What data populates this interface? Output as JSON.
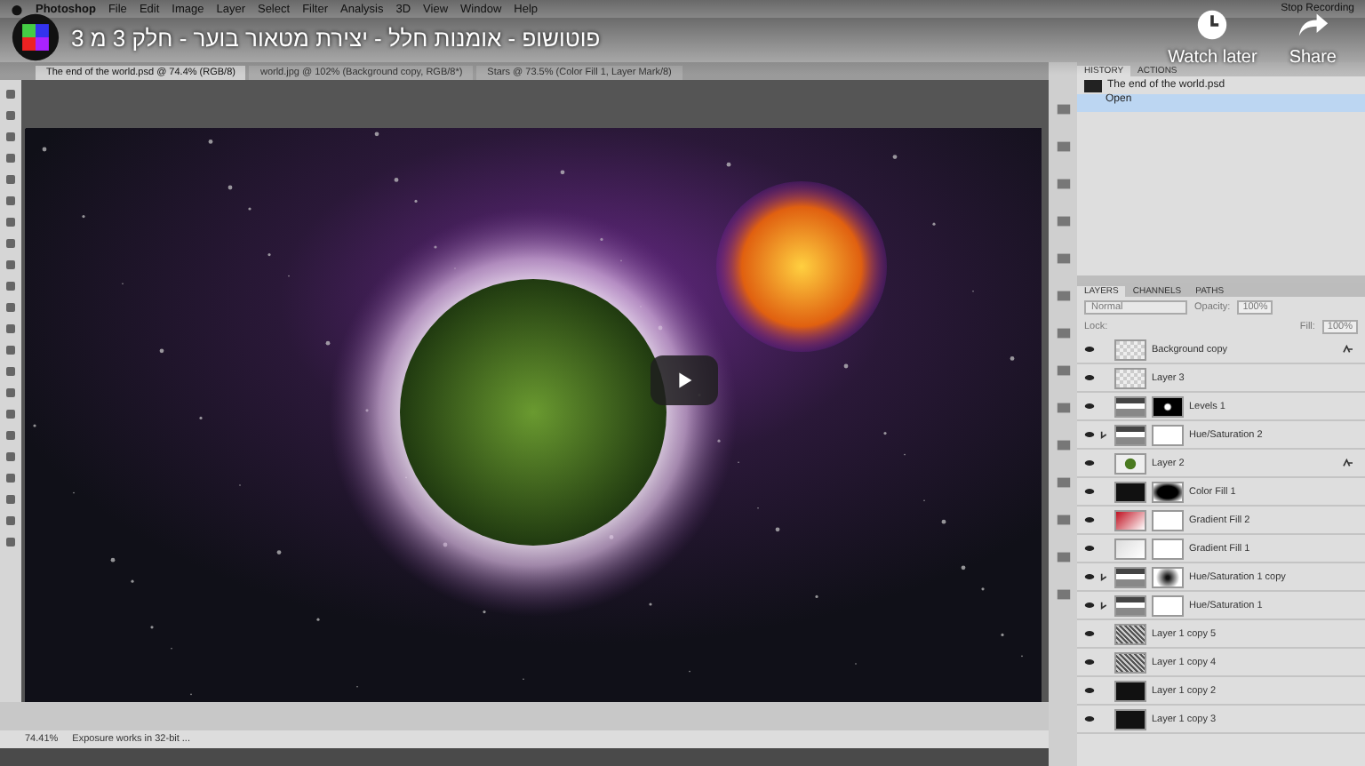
{
  "video": {
    "title": "פוטושופ - אומנות חלל - יצירת מטאור בוער - חלק 3 מ 3",
    "actions": [
      {
        "kind": "clock",
        "label": "Watch later"
      },
      {
        "kind": "share",
        "label": "Share"
      }
    ]
  },
  "menubar": {
    "app": "Photoshop",
    "items": [
      "File",
      "Edit",
      "Image",
      "Layer",
      "Select",
      "Filter",
      "Analysis",
      "3D",
      "View",
      "Window",
      "Help"
    ],
    "recording": "Stop Recording"
  },
  "doc_tabs": [
    {
      "label": "The end of the world.psd @ 74.4% (RGB/8)",
      "selected": true
    },
    {
      "label": "world.jpg @ 102% (Background copy, RGB/8*)",
      "selected": false
    },
    {
      "label": "Stars @ 73.5% (Color Fill 1, Layer Mark/8)",
      "selected": false
    }
  ],
  "history": {
    "tabs": [
      {
        "label": "HISTORY",
        "selected": true
      },
      {
        "label": "ACTIONS",
        "selected": false
      }
    ],
    "snapshot": "The end of the world.psd",
    "states": [
      {
        "label": "Open",
        "selected": true
      }
    ]
  },
  "layers": {
    "tabs": [
      {
        "label": "LAYERS",
        "selected": true
      },
      {
        "label": "CHANNELS",
        "selected": false
      },
      {
        "label": "PATHS",
        "selected": false
      }
    ],
    "blend": "Normal",
    "opacity_label": "Opacity:",
    "opacity": "100%",
    "lock_label": "Lock:",
    "fill_label": "Fill:",
    "fill": "100%",
    "rows": [
      {
        "name": "Background copy",
        "thumb": {
          "kind": "transparent"
        },
        "clipped": false,
        "fx": true
      },
      {
        "name": "Layer 3",
        "thumb": {
          "kind": "transparent"
        },
        "clipped": false,
        "fx": false
      },
      {
        "name": "Levels 1",
        "thumb": {
          "kind": "adjustment"
        },
        "mask": {
          "kind": "dot"
        },
        "clipped": false,
        "fx": false
      },
      {
        "name": "Hue/Saturation 2",
        "thumb": {
          "kind": "adjustment"
        },
        "mask": {
          "kind": "white"
        },
        "clipped": true,
        "fx": false
      },
      {
        "name": "Layer 2",
        "thumb": {
          "kind": "planet"
        },
        "clipped": false,
        "fx": true
      },
      {
        "name": "Color Fill 1",
        "thumb": {
          "kind": "black"
        },
        "mask": {
          "kind": "blur"
        },
        "clipped": false,
        "fx": false
      },
      {
        "name": "Gradient Fill 2",
        "thumb": {
          "kind": "gradient"
        },
        "mask": {
          "kind": "white"
        },
        "clipped": false,
        "fx": false
      },
      {
        "name": "Gradient Fill 1",
        "thumb": {
          "kind": "white"
        },
        "mask": {
          "kind": "white"
        },
        "clipped": false,
        "fx": false
      },
      {
        "name": "Hue/Saturation 1 copy",
        "thumb": {
          "kind": "adjustment"
        },
        "mask": {
          "kind": "radial"
        },
        "clipped": true,
        "fx": false
      },
      {
        "name": "Hue/Saturation 1",
        "thumb": {
          "kind": "adjustment"
        },
        "mask": {
          "kind": "white"
        },
        "clipped": true,
        "fx": false
      },
      {
        "name": "Layer 1 copy 5",
        "thumb": {
          "kind": "noise"
        },
        "clipped": false,
        "fx": false
      },
      {
        "name": "Layer 1 copy 4",
        "thumb": {
          "kind": "noise"
        },
        "clipped": false,
        "fx": false
      },
      {
        "name": "Layer 1 copy 2",
        "thumb": {
          "kind": "black"
        },
        "clipped": false,
        "fx": false
      },
      {
        "name": "Layer 1 copy 3",
        "thumb": {
          "kind": "black"
        },
        "clipped": false,
        "fx": false
      }
    ]
  },
  "status_bar": {
    "zoom": "74.41%",
    "info": "Exposure works in 32-bit ..."
  }
}
